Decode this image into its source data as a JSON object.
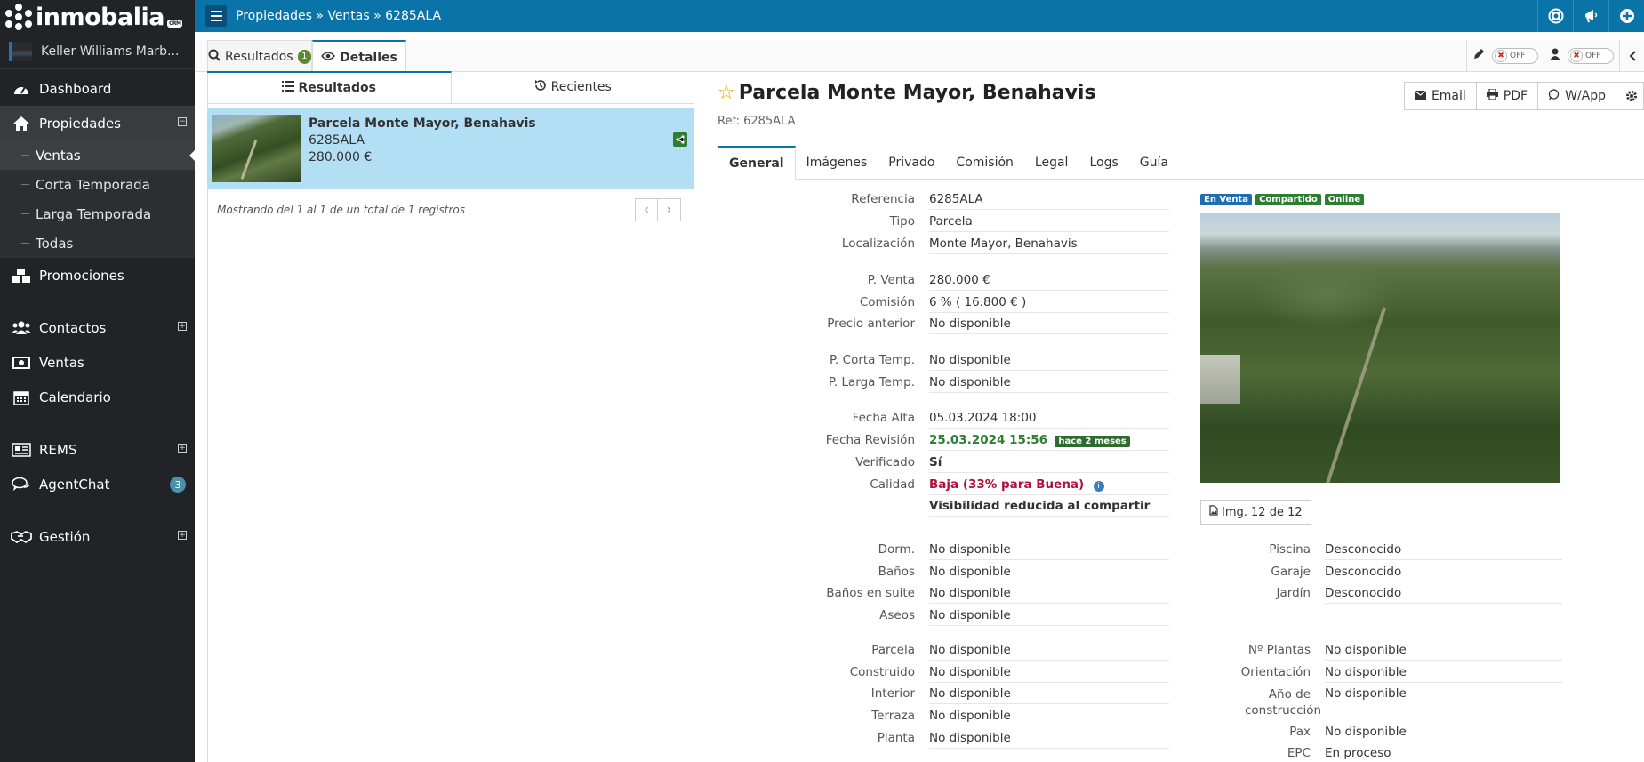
{
  "app": {
    "logo_text": "inmobalia",
    "logo_badge": "CRM",
    "agency_name": "Keller Williams Marb..."
  },
  "sidebar": {
    "items": [
      {
        "label": "Dashboard"
      },
      {
        "label": "Propiedades",
        "expander": "−"
      },
      {
        "label": "Promociones"
      },
      {
        "label": "Contactos",
        "expander": "+"
      },
      {
        "label": "Ventas"
      },
      {
        "label": "Calendario"
      },
      {
        "label": "REMS",
        "expander": "+"
      },
      {
        "label": "AgentChat",
        "badge": "3"
      },
      {
        "label": "Gestión",
        "expander": "+"
      }
    ],
    "propiedades_sub": [
      "Ventas",
      "Corta Temporada",
      "Larga Temporada",
      "Todas"
    ]
  },
  "topbar": {
    "breadcrumb": "Propiedades » Ventas » 6285ALA"
  },
  "tabs": {
    "resultados_label": "Resultados",
    "resultados_count": "1",
    "detalles_label": "Detalles",
    "toggle1": "OFF",
    "toggle2": "OFF"
  },
  "left": {
    "subtab_resultados": "Resultados",
    "subtab_recientes": "Recientes",
    "result": {
      "title": "Parcela Monte Mayor, Benahavis",
      "ref": "6285ALA",
      "price": "280.000 €"
    },
    "paging_text": "Mostrando del 1 al 1 de un total de 1 registros"
  },
  "detail": {
    "title": "Parcela Monte Mayor, Benahavis",
    "ref": "Ref: 6285ALA",
    "actions": {
      "email": "Email",
      "pdf": "PDF",
      "wapp": "W/App"
    },
    "tabs": [
      "General",
      "Imágenes",
      "Privado",
      "Comisión",
      "Legal",
      "Logs",
      "Guía"
    ],
    "fields": {
      "referencia": {
        "label": "Referencia",
        "value": "6285ALA"
      },
      "tipo": {
        "label": "Tipo",
        "value": "Parcela"
      },
      "localizacion": {
        "label": "Localización",
        "value": "Monte Mayor, Benahavis"
      },
      "p_venta": {
        "label": "P. Venta",
        "value": "280.000 €"
      },
      "comision": {
        "label": "Comisión",
        "value": "6 % ( 16.800 € )"
      },
      "precio_anterior": {
        "label": "Precio anterior",
        "value": "No disponible"
      },
      "p_corta": {
        "label": "P. Corta Temp.",
        "value": "No disponible"
      },
      "p_larga": {
        "label": "P. Larga Temp.",
        "value": "No disponible"
      },
      "fecha_alta": {
        "label": "Fecha Alta",
        "value": "05.03.2024 18:00"
      },
      "fecha_revision": {
        "label": "Fecha Revisión",
        "value": "25.03.2024 15:56",
        "tag": "hace 2 meses"
      },
      "verificado": {
        "label": "Verificado",
        "value": "Sí"
      },
      "calidad": {
        "label": "Calidad",
        "value": "Baja (33% para Buena)"
      },
      "visibilidad": {
        "value": "Visibilidad reducida al compartir"
      },
      "dorm": {
        "label": "Dorm.",
        "value": "No disponible"
      },
      "banos": {
        "label": "Baños",
        "value": "No disponible"
      },
      "banos_suite": {
        "label": "Baños en suite",
        "value": "No disponible"
      },
      "aseos": {
        "label": "Aseos",
        "value": "No disponible"
      },
      "parcela": {
        "label": "Parcela",
        "value": "No disponible"
      },
      "construido": {
        "label": "Construido",
        "value": "No disponible"
      },
      "interior": {
        "label": "Interior",
        "value": "No disponible"
      },
      "terraza": {
        "label": "Terraza",
        "value": "No disponible"
      },
      "planta": {
        "label": "Planta",
        "value": "No disponible"
      },
      "piscina": {
        "label": "Piscina",
        "value": "Desconocido"
      },
      "garaje": {
        "label": "Garaje",
        "value": "Desconocido"
      },
      "jardin": {
        "label": "Jardín",
        "value": "Desconocido"
      },
      "n_plantas": {
        "label": "Nº Plantas",
        "value": "No disponible"
      },
      "orientacion": {
        "label": "Orientación",
        "value": "No disponible"
      },
      "ano_construccion": {
        "label": "Año de construcción",
        "value": "No disponible"
      },
      "pax": {
        "label": "Pax",
        "value": "No disponible"
      },
      "epc": {
        "label": "EPC",
        "value": "En proceso"
      }
    },
    "badges": [
      {
        "label": "En Venta",
        "color": "#1f6fb0"
      },
      {
        "label": "Compartido",
        "color": "#2e7d32"
      },
      {
        "label": "Online",
        "color": "#2e7d32"
      }
    ],
    "image_counter": "Img. 12 de 12"
  }
}
